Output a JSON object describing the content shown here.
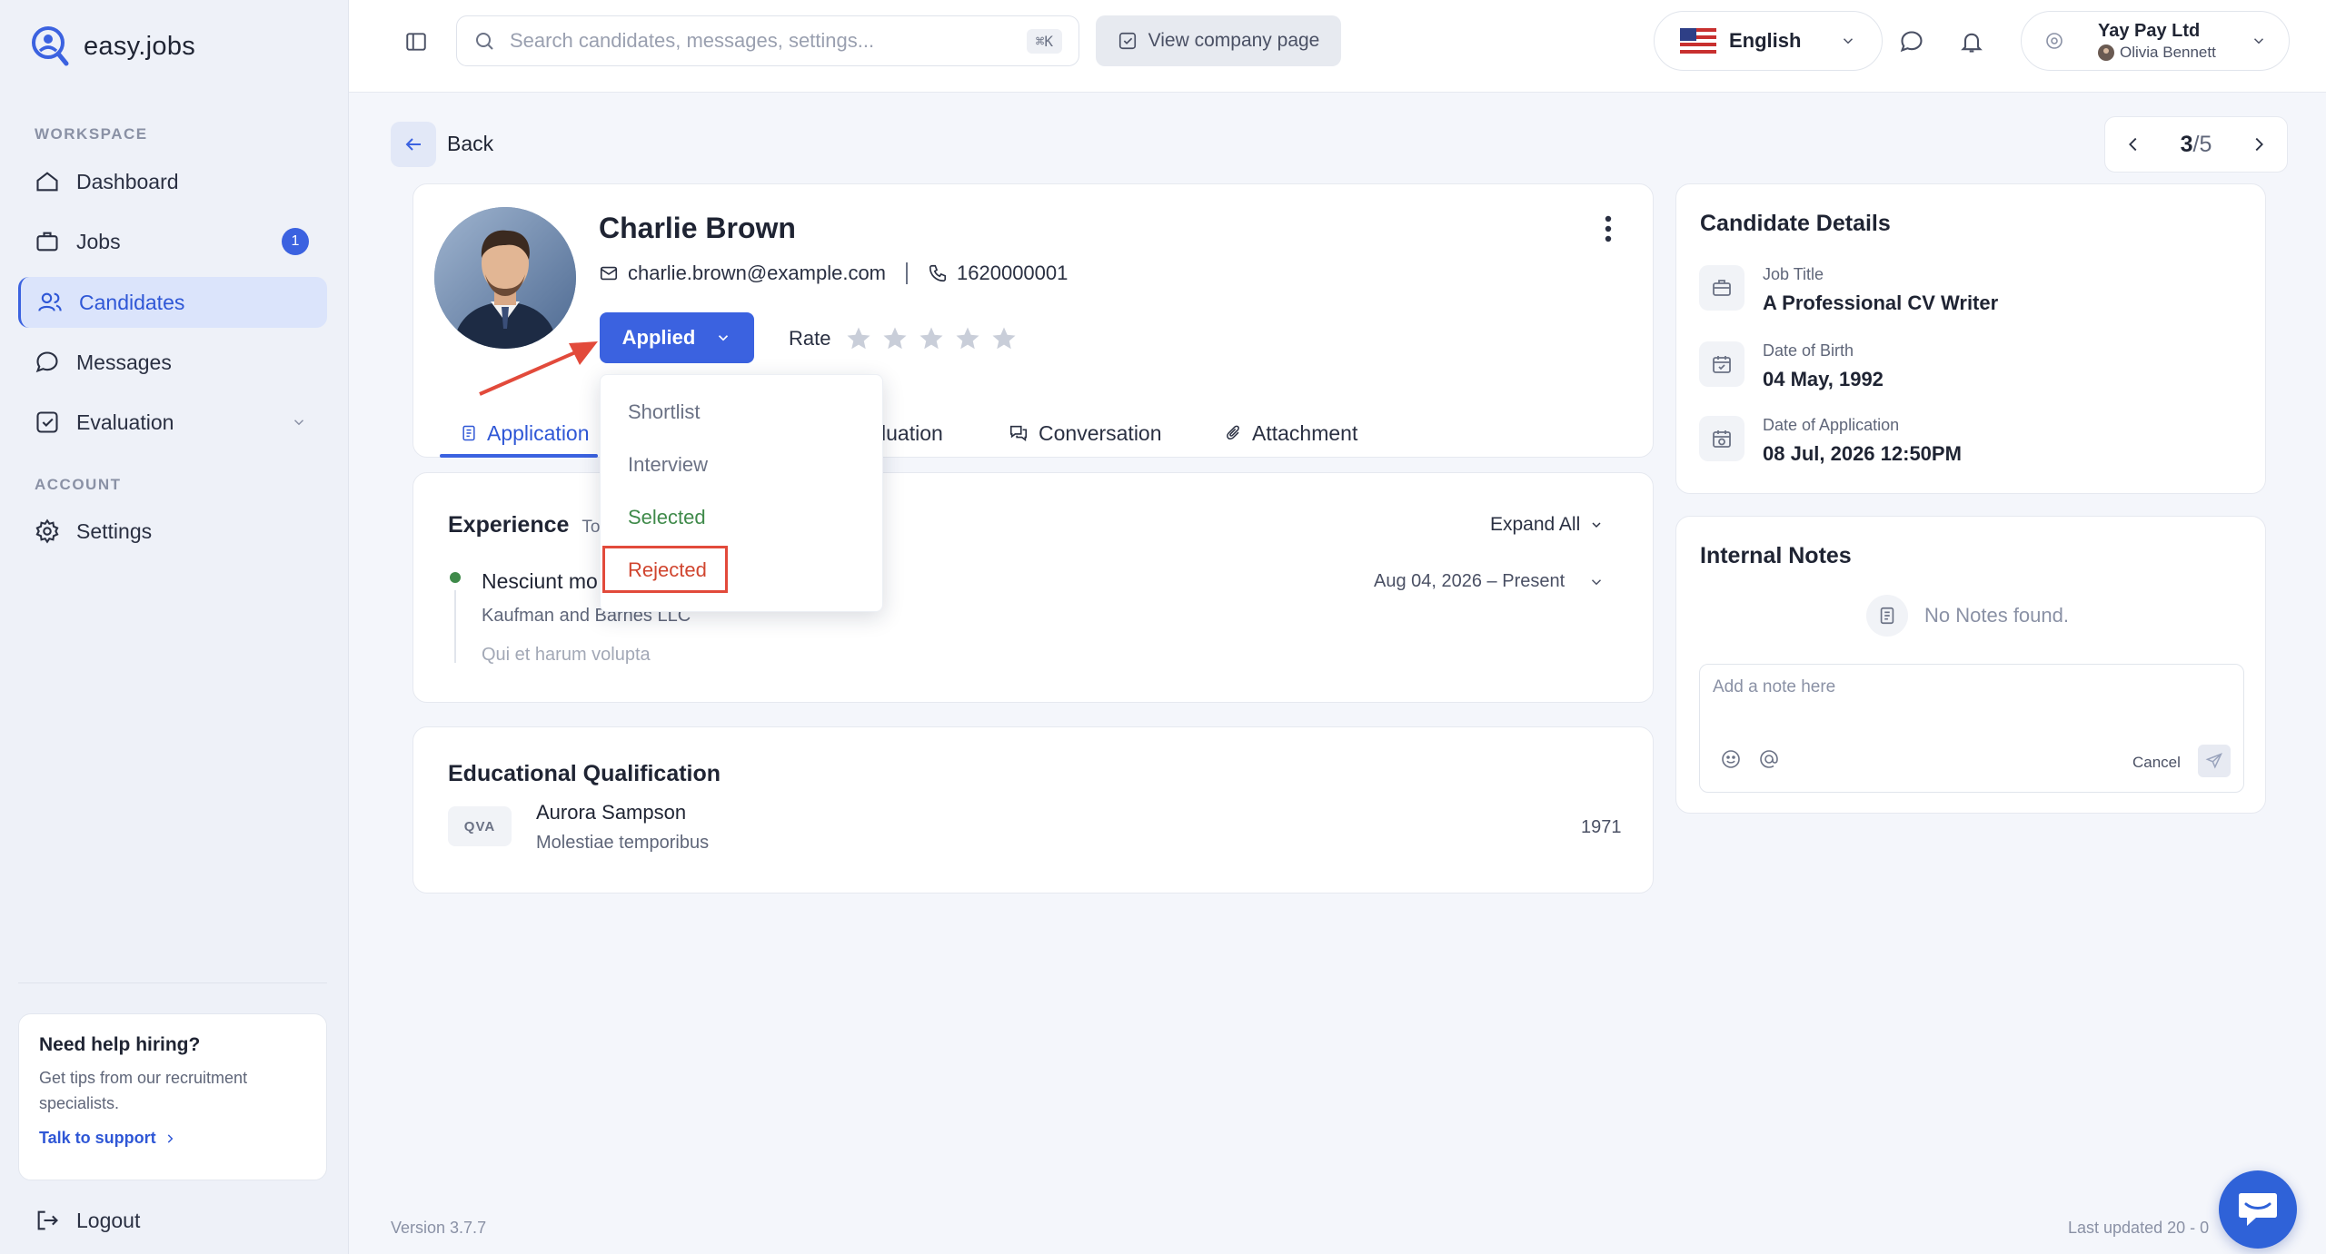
{
  "brand": {
    "name": "easy.jobs",
    "accent": "#3b62e0"
  },
  "sidebar": {
    "workspace_label": "WORKSPACE",
    "account_label": "ACCOUNT",
    "items": [
      {
        "label": "Dashboard",
        "icon": "home-icon"
      },
      {
        "label": "Jobs",
        "icon": "briefcase-icon",
        "badge": "1"
      },
      {
        "label": "Candidates",
        "icon": "users-icon",
        "active": true
      },
      {
        "label": "Messages",
        "icon": "chat-icon"
      },
      {
        "label": "Evaluation",
        "icon": "checklist-icon"
      },
      {
        "label": "Settings",
        "icon": "gear-icon"
      }
    ],
    "help": {
      "title": "Need help hiring?",
      "text": "Get tips from our recruitment specialists.",
      "link": "Talk to support"
    },
    "logout": "Logout"
  },
  "topbar": {
    "search_placeholder": "Search candidates, messages, settings...",
    "search_shortcut": "⌘K",
    "view_company": "View company page",
    "language": "English",
    "company": "Yay Pay Ltd",
    "user": "Olivia Bennett"
  },
  "nav": {
    "back": "Back",
    "current": "3",
    "total": "/5"
  },
  "candidate": {
    "name": "Charlie Brown",
    "email": "charlie.brown@example.com",
    "phone": "1620000001",
    "status": "Applied",
    "rate_label": "Rate",
    "rating": 0,
    "rating_max": 5
  },
  "tabs": [
    {
      "label": "Application",
      "active": true
    },
    {
      "label": "luation"
    },
    {
      "label": "Conversation"
    },
    {
      "label": "Attachment"
    }
  ],
  "status_menu": {
    "options": [
      {
        "label": "Shortlist",
        "color": "#6b7285"
      },
      {
        "label": "Interview",
        "color": "#6b7285"
      },
      {
        "label": "Selected",
        "color": "#3f8a4a"
      },
      {
        "label": "Rejected",
        "color": "#d0452f"
      }
    ]
  },
  "experience": {
    "title": "Experience",
    "total": "Tot",
    "expand_all": "Expand All",
    "entries": [
      {
        "role": "Nesciunt mo",
        "company": "Kaufman and Barnes LLC",
        "description": "Qui et harum volupta",
        "dates": "Aug 04, 2026 – Present"
      }
    ]
  },
  "education": {
    "title": "Educational Qualification",
    "entries": [
      {
        "badge": "QVA",
        "name": "Aurora Sampson",
        "subject": "Molestiae temporibus",
        "year": "1971"
      }
    ]
  },
  "details": {
    "title": "Candidate Details",
    "rows": [
      {
        "label": "Job Title",
        "value": "A Professional CV Writer"
      },
      {
        "label": "Date of Birth",
        "value": "04 May, 1992"
      },
      {
        "label": "Date of Application",
        "value": "08 Jul, 2026 12:50PM"
      }
    ]
  },
  "notes": {
    "title": "Internal Notes",
    "empty": "No Notes found.",
    "placeholder": "Add a note here",
    "cancel": "Cancel"
  },
  "footer": {
    "version": "Version 3.7.7",
    "updated": "Last updated 20 - 0"
  }
}
